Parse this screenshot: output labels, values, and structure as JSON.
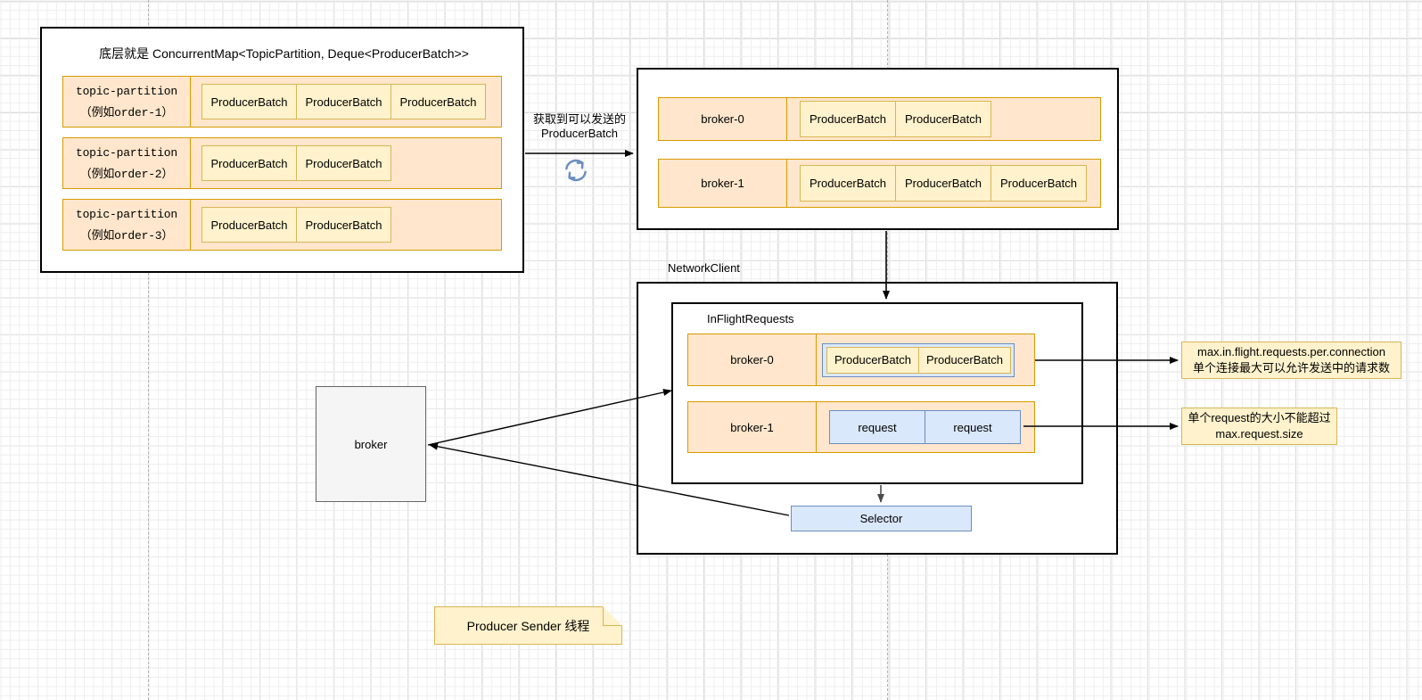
{
  "diagram": {
    "record_accumulator": {
      "title": "底层就是 ConcurrentMap<TopicPartition, Deque<ProducerBatch>>",
      "partitions": [
        {
          "name": "topic-partition",
          "example": "（例如order-1）",
          "batches": [
            "ProducerBatch",
            "ProducerBatch",
            "ProducerBatch"
          ]
        },
        {
          "name": "topic-partition",
          "example": "（例如order-2）",
          "batches": [
            "ProducerBatch",
            "ProducerBatch"
          ]
        },
        {
          "name": "topic-partition",
          "example": "（例如order-3）",
          "batches": [
            "ProducerBatch",
            "ProducerBatch"
          ]
        }
      ]
    },
    "transfer_arrow": {
      "label_line1": "获取到可以发送的",
      "label_line2": "ProducerBatch",
      "icon": "refresh-sync-icon"
    },
    "ready_batches": {
      "brokers": [
        {
          "name": "broker-0",
          "batches": [
            "ProducerBatch",
            "ProducerBatch"
          ]
        },
        {
          "name": "broker-1",
          "batches": [
            "ProducerBatch",
            "ProducerBatch",
            "ProducerBatch"
          ]
        }
      ]
    },
    "network_client": {
      "title": "NetworkClient",
      "in_flight_requests": {
        "title": "InFlightRequests",
        "brokers": [
          {
            "name": "broker-0",
            "items": [
              "ProducerBatch",
              "ProducerBatch"
            ],
            "style": "batch-in-request"
          },
          {
            "name": "broker-1",
            "items": [
              "request",
              "request"
            ],
            "style": "request"
          }
        ]
      },
      "selector": "Selector"
    },
    "broker_node": {
      "label": "broker"
    },
    "annotations": [
      {
        "line1": "max.in.flight.requests.per.connection",
        "line2": "单个连接最大可以允许发送中的请求数"
      },
      {
        "line1": "单个request的大小不能超过",
        "line2": "max.request.size"
      }
    ],
    "sticky_note": {
      "label": "Producer Sender 线程"
    },
    "colors": {
      "orange_fill": "#ffe6cc",
      "orange_stroke": "#d79b00",
      "yellow_fill": "#fff2cc",
      "yellow_stroke": "#d6b656",
      "blue_fill": "#dae8fc",
      "blue_stroke": "#6c8ebf",
      "grey_fill": "#f5f5f5",
      "grey_stroke": "#666666",
      "line": "#000000"
    }
  }
}
